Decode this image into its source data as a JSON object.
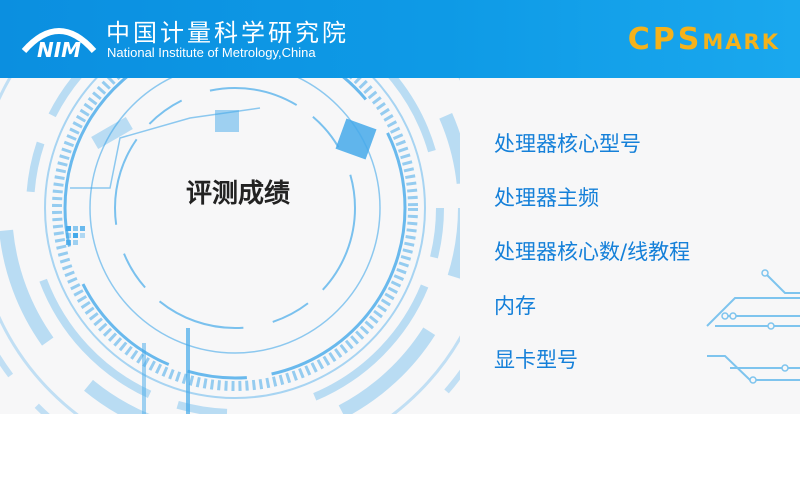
{
  "header": {
    "org_name_cn": "中国计量科学研究院",
    "org_name_en": "National Institute of Metrology,China",
    "logo_text": "NIM",
    "brand_main": "CPS",
    "brand_sub": "MARK"
  },
  "main": {
    "title": "评测成绩",
    "items": [
      {
        "label": "处理器核心型号"
      },
      {
        "label": "处理器主频"
      },
      {
        "label": "处理器核心数/线教程"
      },
      {
        "label": "内存"
      },
      {
        "label": "显卡型号"
      }
    ]
  },
  "colors": {
    "header_bg": "#0e9ae6",
    "brand": "#f5b21a",
    "item_text": "#1580d9",
    "panel_bg": "#f7f7f8",
    "decor": "#45a9ea"
  }
}
